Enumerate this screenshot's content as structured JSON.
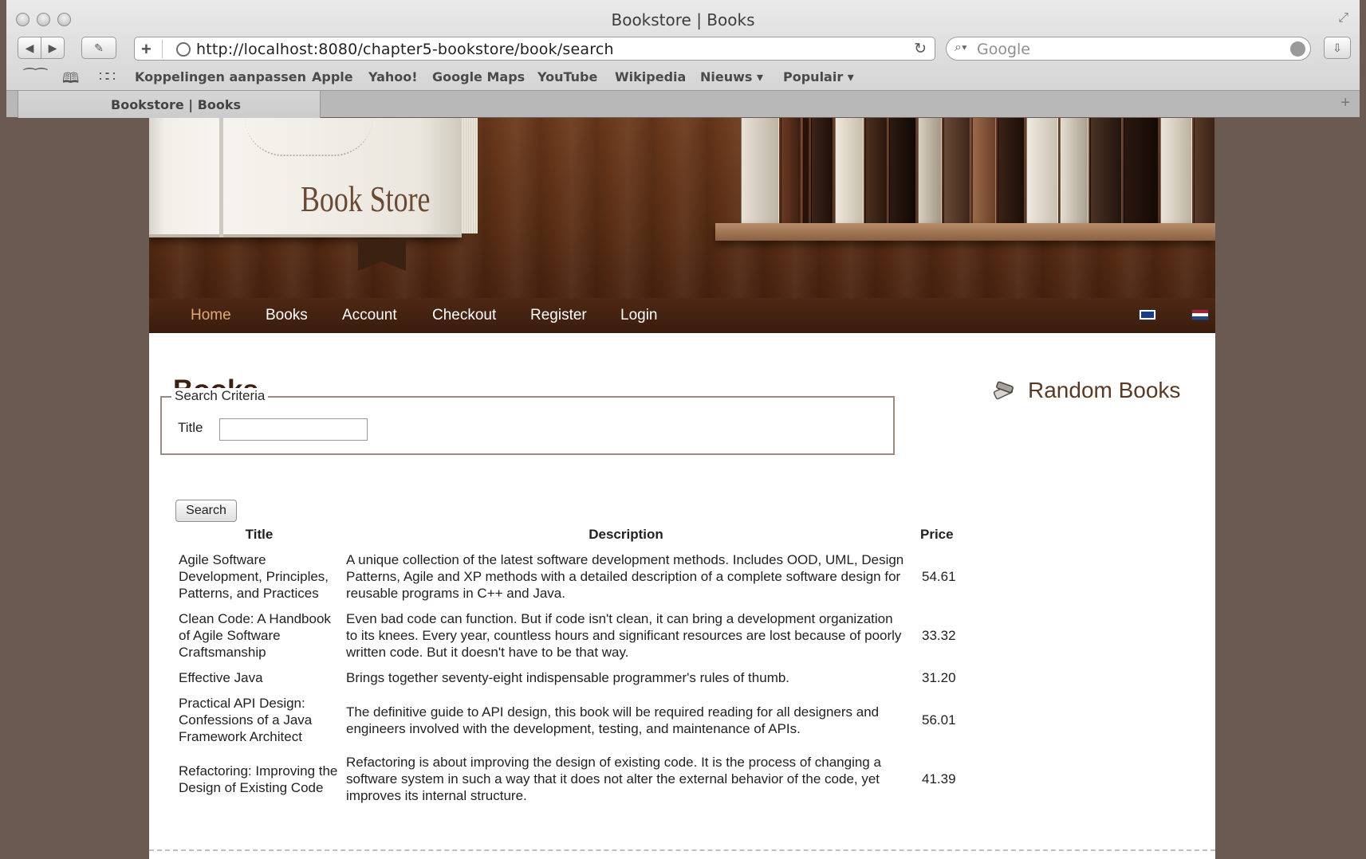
{
  "browser": {
    "window_title": "Bookstore | Books",
    "url": "http://localhost:8080/chapter5-bookstore/book/search",
    "search_placeholder": "Google",
    "bookmarks": [
      "Koppelingen aanpassen",
      "Apple",
      "Yahoo!",
      "Google Maps",
      "YouTube",
      "Wikipedia",
      "Nieuws ▾",
      "Populair ▾"
    ],
    "tab_label": "Bookstore | Books"
  },
  "site": {
    "brand": "Book Store",
    "nav": [
      "Home",
      "Books",
      "Account",
      "Checkout",
      "Register",
      "Login"
    ],
    "active_nav": "Home"
  },
  "main": {
    "heading": "Books",
    "criteria_legend": "Search Criteria",
    "title_label": "Title",
    "title_value": "",
    "search_button": "Search",
    "columns": [
      "Title",
      "Description",
      "Price"
    ],
    "rows": [
      {
        "title": "Agile Software Development, Principles, Patterns, and Practices",
        "description": "A unique collection of the latest software development methods. Includes OOD, UML, Design Patterns, Agile and XP methods with a detailed description of a complete software design for reusable programs in C++ and Java.",
        "price": "54.61"
      },
      {
        "title": "Clean Code: A Handbook of Agile Software Craftsmanship",
        "description": "Even bad code can function. But if code isn't clean, it can bring a development organization to its knees. Every year, countless hours and significant resources are lost because of poorly written code. But it doesn't have to be that way.",
        "price": "33.32"
      },
      {
        "title": "Effective Java",
        "description": "Brings together seventy-eight indispensable programmer's rules of thumb.",
        "price": "31.20"
      },
      {
        "title": "Practical API Design: Confessions of a Java Framework Architect",
        "description": "The definitive guide to API design, this book will be required reading for all designers and engineers involved with the development, testing, and maintenance of APIs.",
        "price": "56.01"
      },
      {
        "title": "Refactoring: Improving the Design of Existing Code",
        "description": "Refactoring is about improving the design of existing code. It is the process of changing a software system in such a way that it does not alter the external behavior of the code, yet improves its internal structure.",
        "price": "41.39"
      }
    ]
  },
  "sidebar": {
    "heading": "Random Books",
    "icon": "books-icon"
  },
  "colors": {
    "page_background": "#6b5a52",
    "nav_background": "#3a1c0d",
    "nav_active": "#e0a878",
    "heading": "#3a2010"
  }
}
